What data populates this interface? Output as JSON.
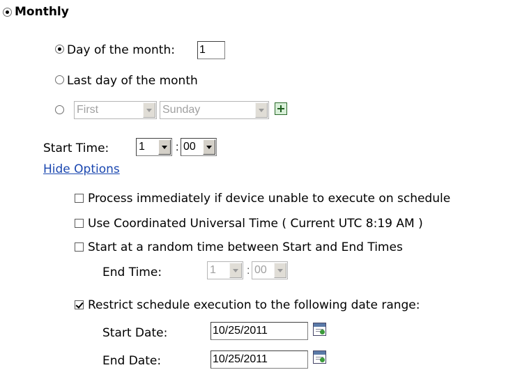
{
  "frequency": {
    "label": "Monthly",
    "selected": true
  },
  "day_of_month": {
    "label": "Day of the month:",
    "value": "1",
    "selected": true
  },
  "last_day": {
    "label": "Last day of the month",
    "selected": false
  },
  "relative": {
    "selected": false,
    "ordinal": "First",
    "weekday": "Sunday"
  },
  "start_time": {
    "label": "Start Time:",
    "hour": "1",
    "separator": ":",
    "minute": "00"
  },
  "options_link": "Hide Options",
  "options": {
    "process_immediately": {
      "label": "Process immediately if device unable to execute on schedule",
      "checked": false
    },
    "use_utc": {
      "label": "Use Coordinated Universal Time ( Current UTC 8:19 AM )",
      "checked": false
    },
    "random_time": {
      "label": "Start at a random time between Start and End Times",
      "checked": false
    },
    "end_time": {
      "label": "End Time:",
      "hour": "1",
      "separator": ":",
      "minute": "00"
    },
    "restrict_range": {
      "label": "Restrict schedule execution to the following date range:",
      "checked": true
    },
    "start_date": {
      "label": "Start Date:",
      "value": "10/25/2011"
    },
    "end_date": {
      "label": "End Date:",
      "value": "10/25/2011"
    }
  },
  "icons": {
    "add": "plus-icon",
    "calendar": "calendar-icon"
  }
}
